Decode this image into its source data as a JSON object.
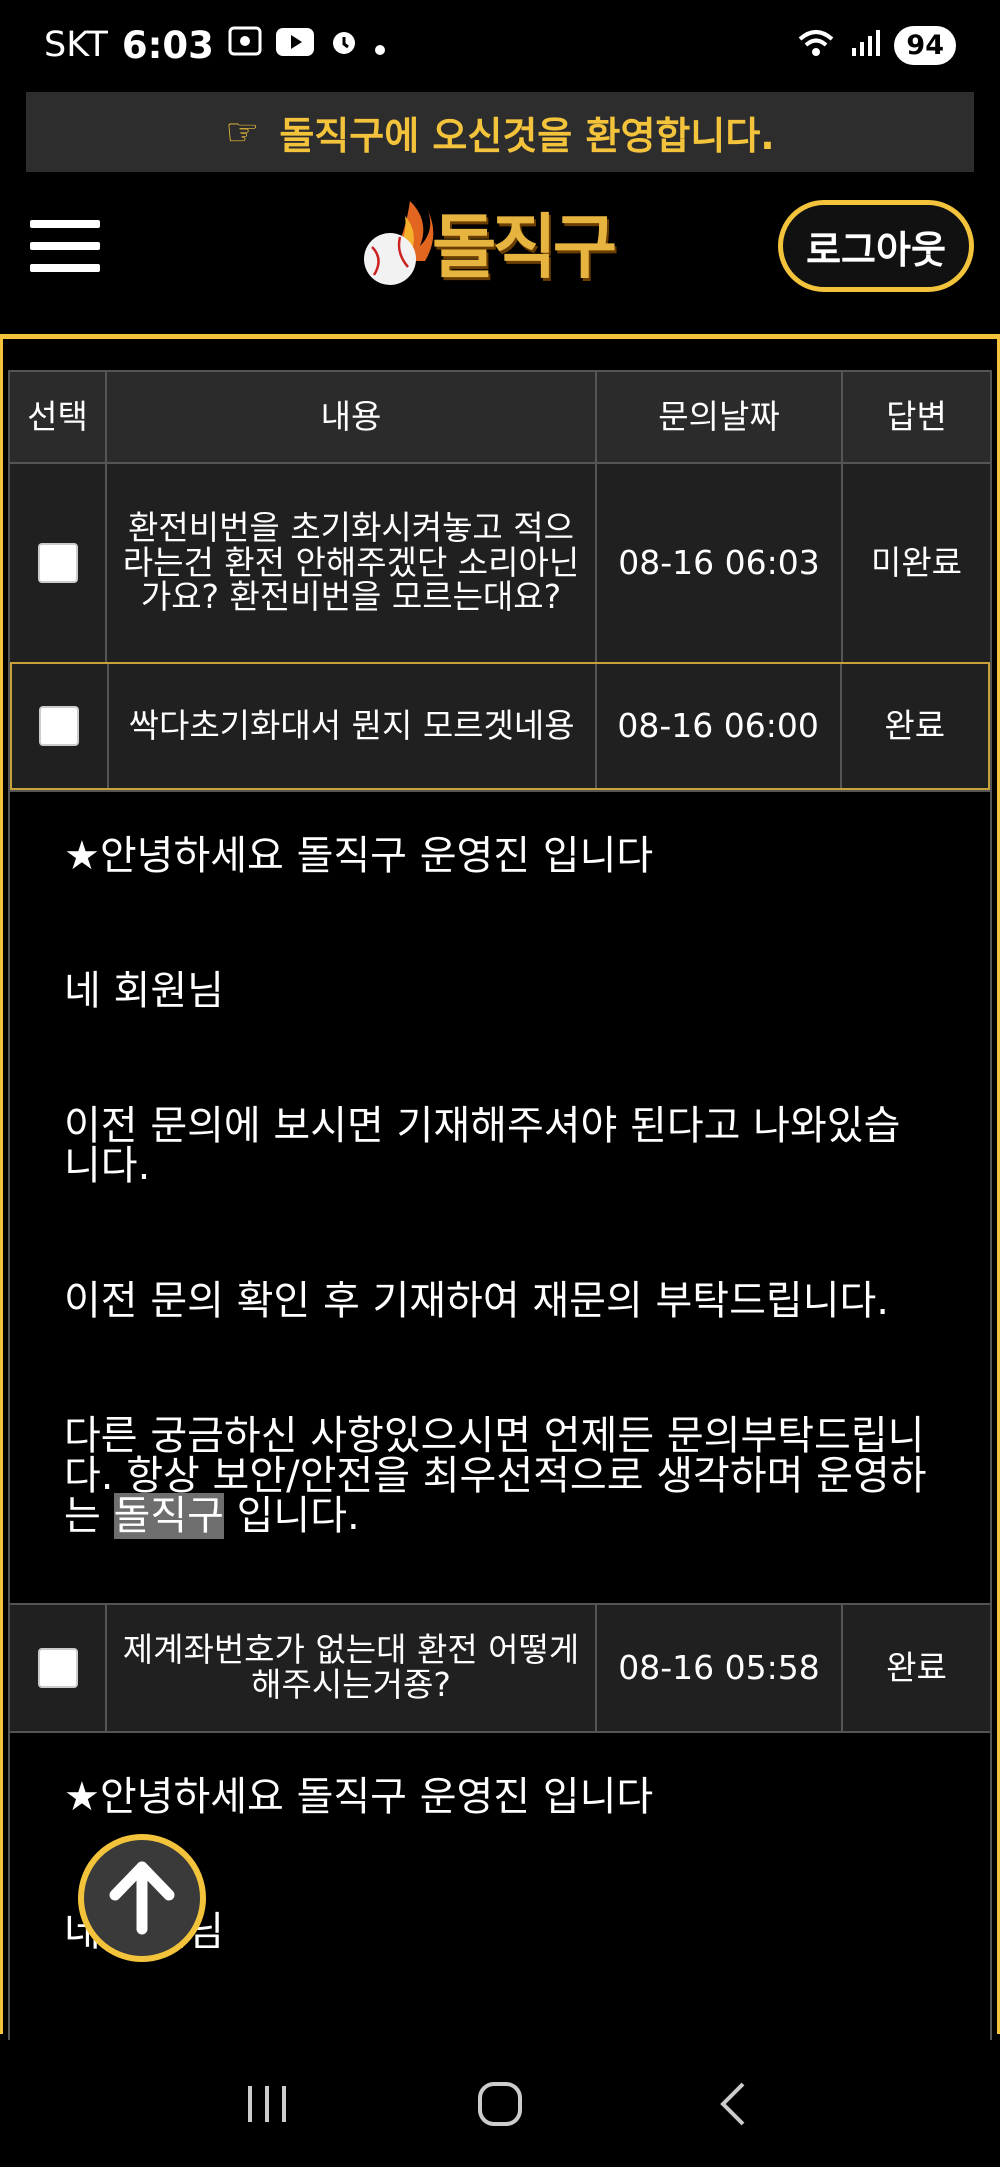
{
  "status_bar": {
    "carrier": "SKT",
    "time": "6:03",
    "battery": "94"
  },
  "welcome": {
    "icon": "pointing-hand-icon",
    "text": "돌직구에 오신것을 환영합니다."
  },
  "header": {
    "logo_text": "돌직구",
    "logout_label": "로그아웃"
  },
  "colors": {
    "accent": "#f3c33c",
    "background": "#000000",
    "row_bg": "#202020"
  },
  "table": {
    "columns": [
      "선택",
      "내용",
      "문의날짜",
      "답변"
    ],
    "rows": [
      {
        "content": "환전비번을 초기화시켜놓고 적으라는건 환전 안해주겠단 소리아닌가요? 환전비번을 모르는대요?",
        "date": "08-16 06:03",
        "status": "미완료"
      },
      {
        "content": "싹다초기화대서 뭔지 모르겟네용",
        "date": "08-16 06:00",
        "status": "완료"
      },
      {
        "content": "제계좌번호가 없는대 환전 어떻게 해주시는거죵?",
        "date": "08-16 05:58",
        "status": "완료"
      }
    ],
    "answers": [
      {
        "greeting": "★안녕하세요 돌직구 운영진 입니다",
        "salutation": "네 회원님",
        "para1": "이전 문의에 보시면 기재해주셔야 된다고 나와있습니다.",
        "para2": "이전 문의 확인 후 기재하여 재문의 부탁드립니다.",
        "para3_before": "다른 궁금하신 사항있으시면 언제든 문의부탁드립니다. 항상 보안/안전을 최우선적으로 생각하며 운영하는 ",
        "para3_highlight": "돌직구",
        "para3_after": " 입니다."
      },
      {
        "greeting": "★안녕하세요 돌직구 운영진 입니다",
        "salutation": "네 회원님"
      }
    ]
  }
}
